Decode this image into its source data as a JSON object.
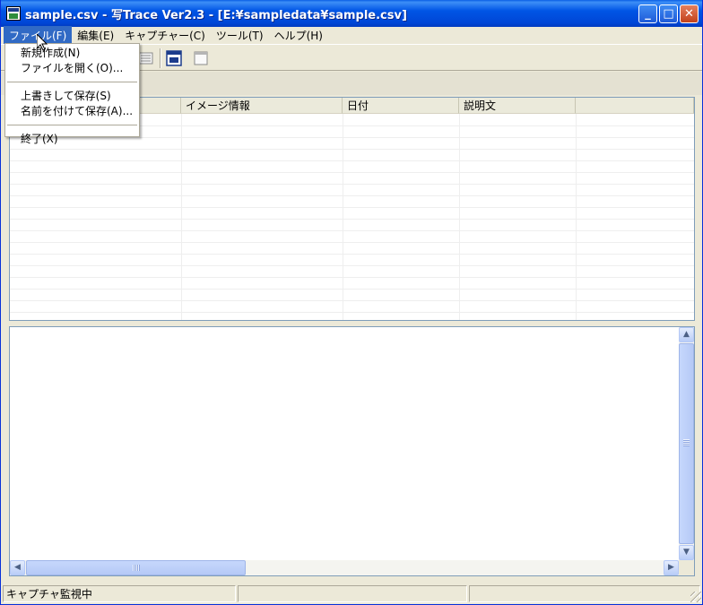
{
  "window": {
    "title": "sample.csv - 写Trace Ver2.3 - [E:¥sampledata¥sample.csv]",
    "minimize_glyph": "_",
    "maximize_glyph": "□",
    "close_glyph": "✕"
  },
  "menubar": {
    "items": [
      {
        "label": "ファイル(F)",
        "active": true
      },
      {
        "label": "編集(E)"
      },
      {
        "label": "キャプチャー(C)"
      },
      {
        "label": "ツール(T)"
      },
      {
        "label": "ヘルプ(H)"
      }
    ]
  },
  "file_menu": {
    "items": [
      "新規作成(N)",
      "ファイルを開く(O)...",
      "上書きして保存(S)",
      "名前を付けて保存(A)...",
      "終了(X)"
    ]
  },
  "list": {
    "columns": [
      "",
      "イメージ情報",
      "日付",
      "説明文",
      ""
    ],
    "rows": []
  },
  "statusbar": {
    "panels": [
      "キャプチャ監視中",
      "",
      ""
    ]
  },
  "colors": {
    "title_blue": "#0055e5",
    "menu_highlight": "#316ac5",
    "window_face": "#ece9d8"
  }
}
